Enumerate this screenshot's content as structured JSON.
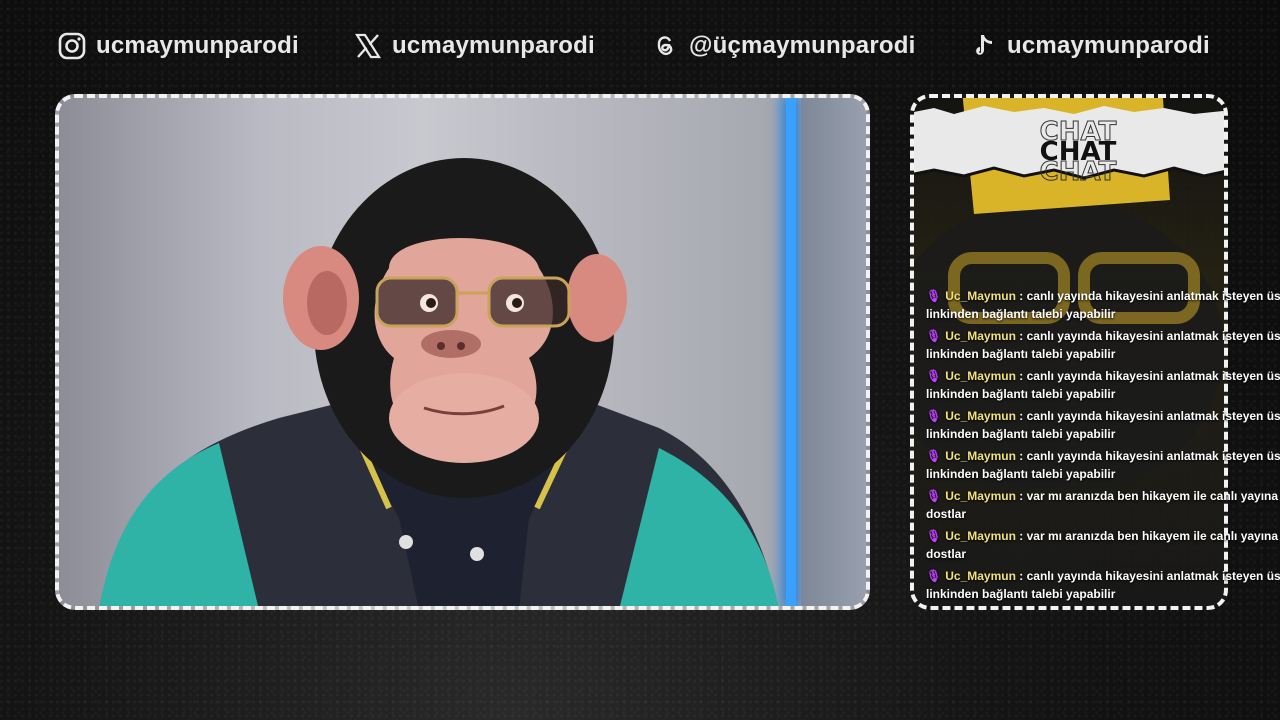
{
  "socials": [
    {
      "icon": "instagram-icon",
      "handle": "ucmaymunparodi"
    },
    {
      "icon": "x-twitter-icon",
      "handle": "ucmaymunparodi"
    },
    {
      "icon": "threads-icon",
      "handle": "@üçmaymunparodi"
    },
    {
      "icon": "tiktok-icon",
      "handle": "ucmaymunparodi"
    }
  ],
  "chat": {
    "title": "CHAT",
    "accent_color": "#d9b428",
    "messages": [
      {
        "user": "Uc_Maymun",
        "text": ": canlı yayında hikayesini anlatmak isteyen üsttel",
        "text2": "linkinden bağlantı talebi yapabilir"
      },
      {
        "user": "Uc_Maymun",
        "text": ": canlı yayında hikayesini anlatmak isteyen üsttel",
        "text2": "linkinden bağlantı talebi yapabilir"
      },
      {
        "user": "Uc_Maymun",
        "text": ": canlı yayında hikayesini anlatmak isteyen üsttel",
        "text2": "linkinden bağlantı talebi yapabilir"
      },
      {
        "user": "Uc_Maymun",
        "text": ": canlı yayında hikayesini anlatmak isteyen üsttel",
        "text2": "linkinden bağlantı talebi yapabilir"
      },
      {
        "user": "Uc_Maymun",
        "text": ": canlı yayında hikayesini anlatmak isteyen üsttel",
        "text2": "linkinden bağlantı talebi yapabilir"
      },
      {
        "user": "Uc_Maymun",
        "text": ": var mı aranızda ben hikayem ile canlı yayına des",
        "text2": "dostlar"
      },
      {
        "user": "Uc_Maymun",
        "text": ": var mı aranızda ben hikayem ile canlı yayına des",
        "text2": "dostlar"
      },
      {
        "user": "Uc_Maymun",
        "text": ": canlı yayında hikayesini anlatmak isteyen üsttel",
        "text2": "linkinden bağlantı talebi yapabilir"
      }
    ]
  }
}
